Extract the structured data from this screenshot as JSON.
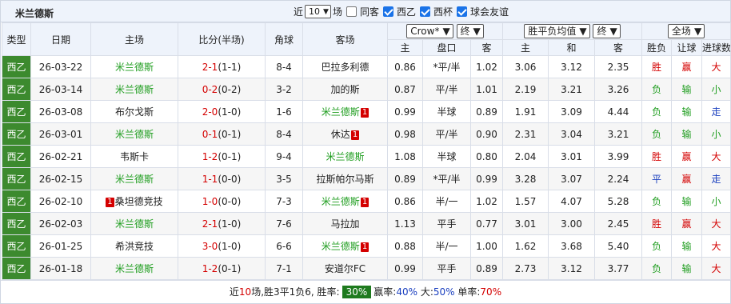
{
  "title": "米兰德斯",
  "filters": {
    "recent_label": "近",
    "recent_count": "10",
    "recent_suffix": "场",
    "same_home_label": "同客",
    "league_label": "西乙",
    "cup_label": "西杯",
    "friendly_label": "球会友谊"
  },
  "headers": {
    "type": "类型",
    "date": "日期",
    "home": "主场",
    "score": "比分(半场)",
    "corner": "角球",
    "away": "客场",
    "company": "Crow*",
    "company_end": "终",
    "odds_type": "胜平负均值",
    "odds_end": "终",
    "all": "全场",
    "sub_home": "主",
    "sub_handicap": "盘口",
    "sub_away": "客",
    "sub_home2": "主",
    "sub_draw": "和",
    "sub_away2": "客",
    "result": "胜负",
    "handicap_result": "让球",
    "goals_result": "进球数"
  },
  "rows": [
    {
      "type": "西乙",
      "date": "26-03-22",
      "home": "米兰德斯",
      "home_hl": true,
      "home_badge": "",
      "score": "2-1",
      "half": "(1-1)",
      "corner": "8-4",
      "away": "巴拉多利德",
      "away_hl": false,
      "away_badge": "",
      "h1": "0.86",
      "hcap": "*平/半",
      "a1": "1.02",
      "w": "3.06",
      "d": "3.12",
      "l": "2.35",
      "res": "胜",
      "res_c": "red",
      "hres": "赢",
      "hres_c": "red",
      "gres": "大",
      "gres_c": "red"
    },
    {
      "type": "西乙",
      "date": "26-03-14",
      "home": "米兰德斯",
      "home_hl": true,
      "home_badge": "",
      "score": "0-2",
      "half": "(0-2)",
      "corner": "3-2",
      "away": "加的斯",
      "away_hl": false,
      "away_badge": "",
      "h1": "0.87",
      "hcap": "平/半",
      "a1": "1.01",
      "w": "2.19",
      "d": "3.21",
      "l": "3.26",
      "res": "负",
      "res_c": "green",
      "hres": "输",
      "hres_c": "green",
      "gres": "小",
      "gres_c": "green"
    },
    {
      "type": "西乙",
      "date": "26-03-08",
      "home": "布尔戈斯",
      "home_hl": false,
      "home_badge": "",
      "score": "2-0",
      "half": "(1-0)",
      "corner": "1-6",
      "away": "米兰德斯",
      "away_hl": true,
      "away_badge": "1",
      "h1": "0.99",
      "hcap": "半球",
      "a1": "0.89",
      "w": "1.91",
      "d": "3.09",
      "l": "4.44",
      "res": "负",
      "res_c": "green",
      "hres": "输",
      "hres_c": "green",
      "gres": "走",
      "gres_c": "blue"
    },
    {
      "type": "西乙",
      "date": "26-03-01",
      "home": "米兰德斯",
      "home_hl": true,
      "home_badge": "",
      "score": "0-1",
      "half": "(0-1)",
      "corner": "8-4",
      "away": "休达",
      "away_hl": false,
      "away_badge": "1",
      "h1": "0.98",
      "hcap": "平/半",
      "a1": "0.90",
      "w": "2.31",
      "d": "3.04",
      "l": "3.21",
      "res": "负",
      "res_c": "green",
      "hres": "输",
      "hres_c": "green",
      "gres": "小",
      "gres_c": "green"
    },
    {
      "type": "西乙",
      "date": "26-02-21",
      "home": "韦斯卡",
      "home_hl": false,
      "home_badge": "",
      "score": "1-2",
      "half": "(0-1)",
      "corner": "9-4",
      "away": "米兰德斯",
      "away_hl": true,
      "away_badge": "",
      "h1": "1.08",
      "hcap": "半球",
      "a1": "0.80",
      "w": "2.04",
      "d": "3.01",
      "l": "3.99",
      "res": "胜",
      "res_c": "red",
      "hres": "赢",
      "hres_c": "red",
      "gres": "大",
      "gres_c": "red"
    },
    {
      "type": "西乙",
      "date": "26-02-15",
      "home": "米兰德斯",
      "home_hl": true,
      "home_badge": "",
      "score": "1-1",
      "half": "(0-0)",
      "corner": "3-5",
      "away": "拉斯帕尔马斯",
      "away_hl": false,
      "away_badge": "",
      "h1": "0.89",
      "hcap": "*平/半",
      "a1": "0.99",
      "w": "3.28",
      "d": "3.07",
      "l": "2.24",
      "res": "平",
      "res_c": "blue",
      "hres": "赢",
      "hres_c": "red",
      "gres": "走",
      "gres_c": "blue"
    },
    {
      "type": "西乙",
      "date": "26-02-10",
      "home": "桑坦德竞技",
      "home_hl": false,
      "home_badge": "1",
      "score": "1-0",
      "half": "(0-0)",
      "corner": "7-3",
      "away": "米兰德斯",
      "away_hl": true,
      "away_badge": "1",
      "h1": "0.86",
      "hcap": "半/一",
      "a1": "1.02",
      "w": "1.57",
      "d": "4.07",
      "l": "5.28",
      "res": "负",
      "res_c": "green",
      "hres": "输",
      "hres_c": "green",
      "gres": "小",
      "gres_c": "green"
    },
    {
      "type": "西乙",
      "date": "26-02-03",
      "home": "米兰德斯",
      "home_hl": true,
      "home_badge": "",
      "score": "2-1",
      "half": "(1-0)",
      "corner": "7-6",
      "away": "马拉加",
      "away_hl": false,
      "away_badge": "",
      "h1": "1.13",
      "hcap": "平手",
      "a1": "0.77",
      "w": "3.01",
      "d": "3.00",
      "l": "2.45",
      "res": "胜",
      "res_c": "red",
      "hres": "赢",
      "hres_c": "red",
      "gres": "大",
      "gres_c": "red"
    },
    {
      "type": "西乙",
      "date": "26-01-25",
      "home": "希洪竞技",
      "home_hl": false,
      "home_badge": "",
      "score": "3-0",
      "half": "(1-0)",
      "corner": "6-6",
      "away": "米兰德斯",
      "away_hl": true,
      "away_badge": "1",
      "h1": "0.88",
      "hcap": "半/一",
      "a1": "1.00",
      "w": "1.62",
      "d": "3.68",
      "l": "5.40",
      "res": "负",
      "res_c": "green",
      "hres": "输",
      "hres_c": "green",
      "gres": "大",
      "gres_c": "red"
    },
    {
      "type": "西乙",
      "date": "26-01-18",
      "home": "米兰德斯",
      "home_hl": true,
      "home_badge": "",
      "score": "1-2",
      "half": "(0-1)",
      "corner": "7-1",
      "away": "安道尔FC",
      "away_hl": false,
      "away_badge": "",
      "h1": "0.99",
      "hcap": "平手",
      "a1": "0.89",
      "w": "2.73",
      "d": "3.12",
      "l": "3.77",
      "res": "负",
      "res_c": "green",
      "hres": "输",
      "hres_c": "green",
      "gres": "大",
      "gres_c": "red"
    }
  ],
  "footer": {
    "prefix": "近",
    "count": "10",
    "summary": "场,胜3平1负6, 胜率:",
    "win_rate": "30%",
    "handicap_label": "赢率:",
    "handicap_rate": "40%",
    "big_label": "大:",
    "big_rate": "50%",
    "odd_label": "单率:",
    "odd_rate": "70%"
  },
  "colors": {
    "type_bg": "#3c8a2e",
    "win": "#d40000",
    "lose": "#1f9d1f",
    "draw": "#1a3fbf"
  }
}
